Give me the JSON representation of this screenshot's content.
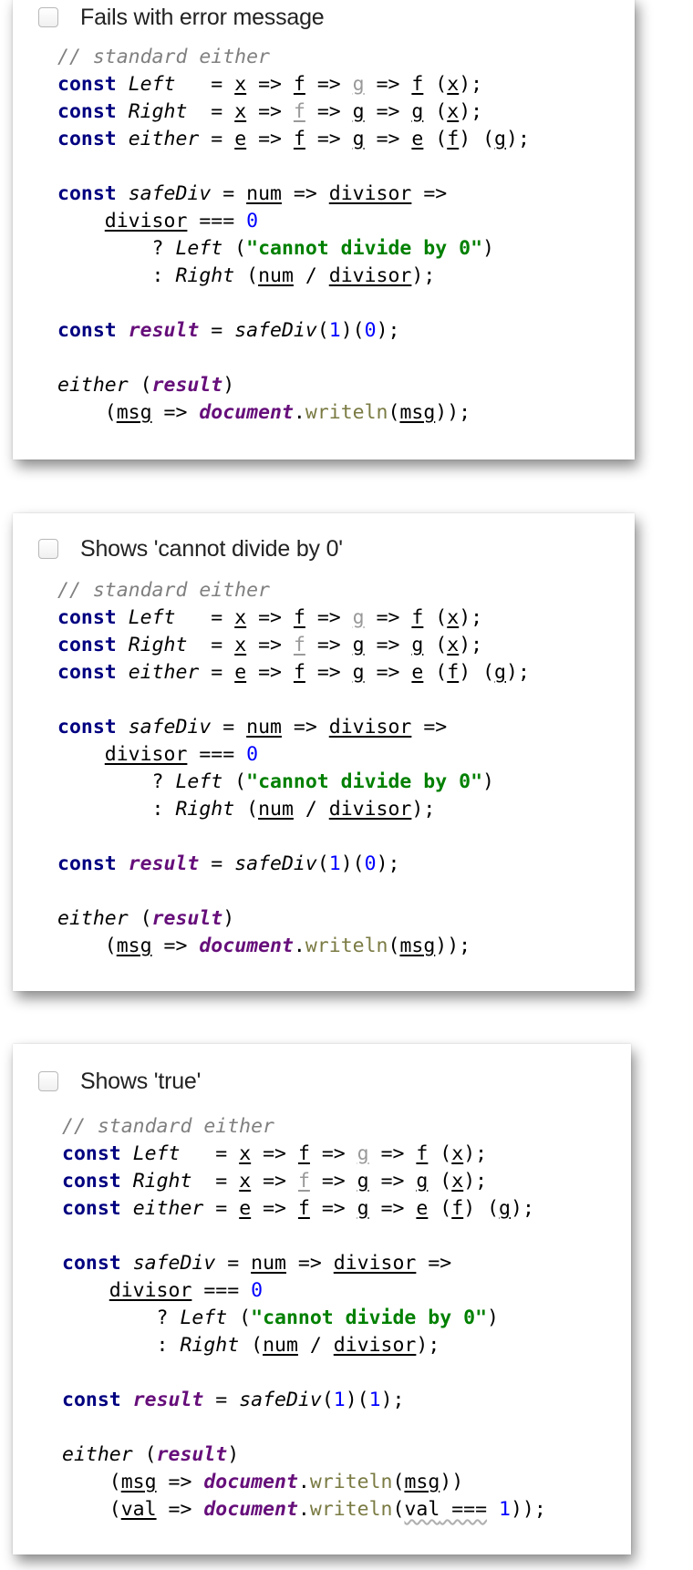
{
  "options": [
    {
      "label": "Fails with error message",
      "checked": false,
      "code": {
        "comment": "// standard either",
        "result_call": {
          "arg1": "1",
          "arg2": "0"
        },
        "has_val_branch": false
      }
    },
    {
      "label": "Shows 'cannot divide by 0'",
      "checked": false,
      "code": {
        "comment": "// standard either",
        "result_call": {
          "arg1": "1",
          "arg2": "0"
        },
        "has_val_branch": false
      }
    },
    {
      "label": "Shows 'true'",
      "checked": false,
      "code": {
        "comment": "// standard either",
        "result_call": {
          "arg1": "1",
          "arg2": "1"
        },
        "has_val_branch": true
      }
    }
  ],
  "code_tokens": {
    "const": "const",
    "left": "Left",
    "right": "Right",
    "either": "either",
    "safeDiv": "safeDiv",
    "result": "result",
    "num": "num",
    "divisor": "divisor",
    "zero": "0",
    "error_string": "\"cannot divide by 0\"",
    "msg": "msg",
    "val": "val",
    "document": "document",
    "writeln": "writeln"
  },
  "colors": {
    "keyword": "#000080",
    "string": "#008000",
    "number": "#0000ff",
    "global": "#660e7a",
    "comment": "#808080"
  }
}
